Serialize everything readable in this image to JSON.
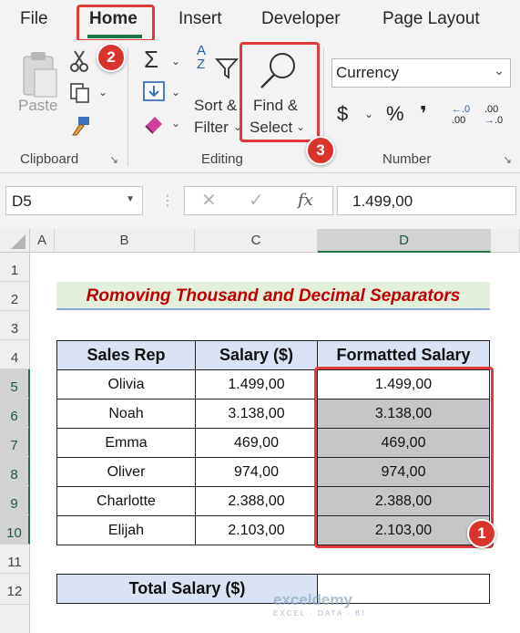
{
  "menu": {
    "tabs": [
      "File",
      "Home",
      "Insert",
      "Developer",
      "Page Layout"
    ],
    "active": "Home"
  },
  "ribbon": {
    "clipboard": {
      "paste_label": "Paste",
      "group_label": "Clipboard"
    },
    "editing": {
      "sort_label": "Sort &",
      "filter_label": "Filter",
      "find_label": "Find &",
      "select_label": "Select",
      "group_label": "Editing"
    },
    "number": {
      "format_value": "Currency",
      "group_label": "Number",
      "currency_symbol": "$",
      "percent_symbol": "%",
      "comma_symbol": "❜",
      "increase_decimal": ".00",
      "decrease_decimal": ".0"
    }
  },
  "formula_bar": {
    "name_box": "D5",
    "fx_label": "fx",
    "value": "1.499,00"
  },
  "sheet": {
    "columns": [
      "A",
      "B",
      "C",
      "D"
    ],
    "rows": [
      "1",
      "2",
      "3",
      "4",
      "5",
      "6",
      "7",
      "8",
      "9",
      "10",
      "11",
      "12"
    ],
    "title": "Romoving Thousand and Decimal Separators",
    "headers": [
      "Sales Rep",
      "Salary ($)",
      "Formatted Salary"
    ],
    "data": [
      [
        "Olivia",
        "1.499,00",
        "1.499,00"
      ],
      [
        "Noah",
        "3.138,00",
        "3.138,00"
      ],
      [
        "Emma",
        "469,00",
        "469,00"
      ],
      [
        "Oliver",
        "974,00",
        "974,00"
      ],
      [
        "Charlotte",
        "2.388,00",
        "2.388,00"
      ],
      [
        "Elijah",
        "2.103,00",
        "2.103,00"
      ]
    ],
    "total_label": "Total Salary ($)",
    "total_value": ""
  },
  "annotations": [
    "1",
    "2",
    "3"
  ],
  "watermark": {
    "brand": "exceldemy",
    "tagline": "EXCEL · DATA · BI"
  },
  "colors": {
    "accent_green": "#217346",
    "highlight_red": "#e03a3a",
    "header_fill": "#dae3f3",
    "title_fill": "#e2efda",
    "title_text": "#c00000"
  }
}
